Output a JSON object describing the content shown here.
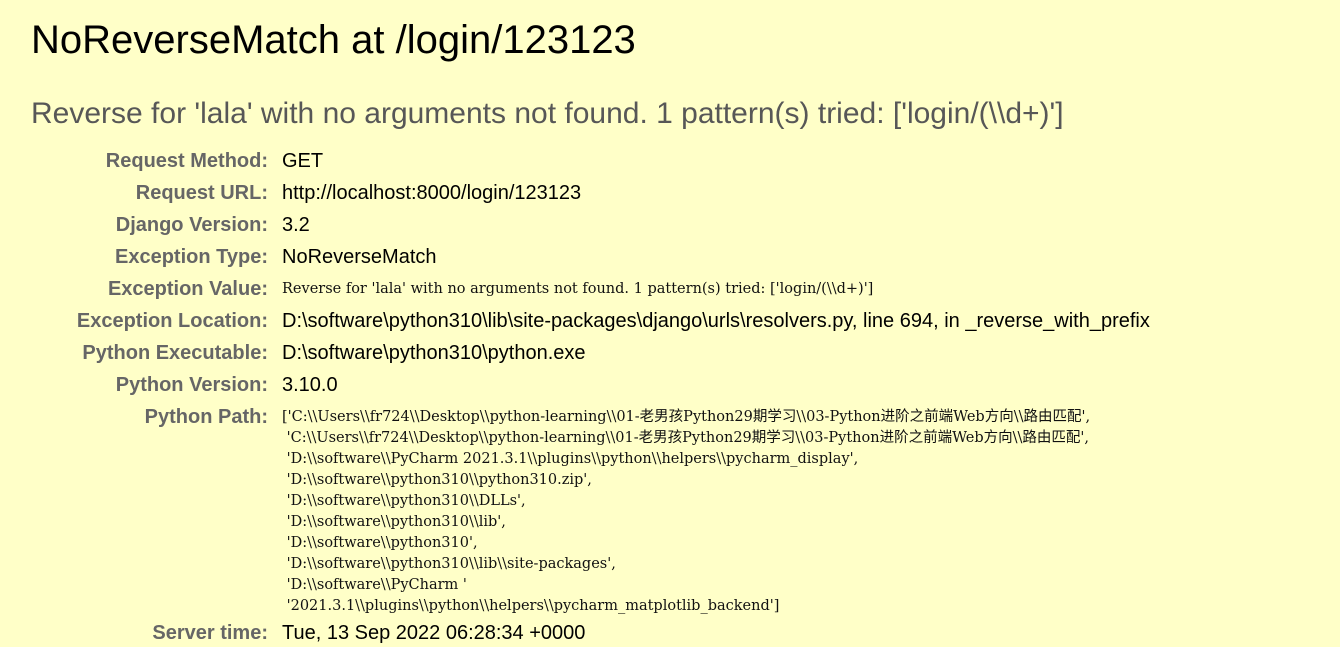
{
  "title": "NoReverseMatch at /login/123123",
  "subtitle": "Reverse for 'lala' with no arguments not found. 1 pattern(s) tried: ['login/(\\\\d+)']",
  "meta": {
    "request_method": {
      "label": "Request Method:",
      "value": "GET"
    },
    "request_url": {
      "label": "Request URL:",
      "value": "http://localhost:8000/login/123123"
    },
    "django_version": {
      "label": "Django Version:",
      "value": "3.2"
    },
    "exception_type": {
      "label": "Exception Type:",
      "value": "NoReverseMatch"
    },
    "exception_value": {
      "label": "Exception Value:",
      "value": "Reverse for 'lala' with no arguments not found. 1 pattern(s) tried: ['login/(\\\\d+)']"
    },
    "exception_location": {
      "label": "Exception Location:",
      "value": "D:\\software\\python310\\lib\\site-packages\\django\\urls\\resolvers.py, line 694, in _reverse_with_prefix"
    },
    "python_executable": {
      "label": "Python Executable:",
      "value": "D:\\software\\python310\\python.exe"
    },
    "python_version": {
      "label": "Python Version:",
      "value": "3.10.0"
    },
    "python_path": {
      "label": "Python Path:",
      "value": "['C:\\\\Users\\\\fr724\\\\Desktop\\\\python-learning\\\\01-老男孩Python29期学习\\\\03-Python进阶之前端Web方向\\\\路由匹配',\n 'C:\\\\Users\\\\fr724\\\\Desktop\\\\python-learning\\\\01-老男孩Python29期学习\\\\03-Python进阶之前端Web方向\\\\路由匹配',\n 'D:\\\\software\\\\PyCharm 2021.3.1\\\\plugins\\\\python\\\\helpers\\\\pycharm_display',\n 'D:\\\\software\\\\python310\\\\python310.zip',\n 'D:\\\\software\\\\python310\\\\DLLs',\n 'D:\\\\software\\\\python310\\\\lib',\n 'D:\\\\software\\\\python310',\n 'D:\\\\software\\\\python310\\\\lib\\\\site-packages',\n 'D:\\\\software\\\\PyCharm '\n '2021.3.1\\\\plugins\\\\python\\\\helpers\\\\pycharm_matplotlib_backend']"
    },
    "server_time": {
      "label": "Server time:",
      "value": "Tue, 13 Sep 2022 06:28:34 +0000"
    }
  }
}
